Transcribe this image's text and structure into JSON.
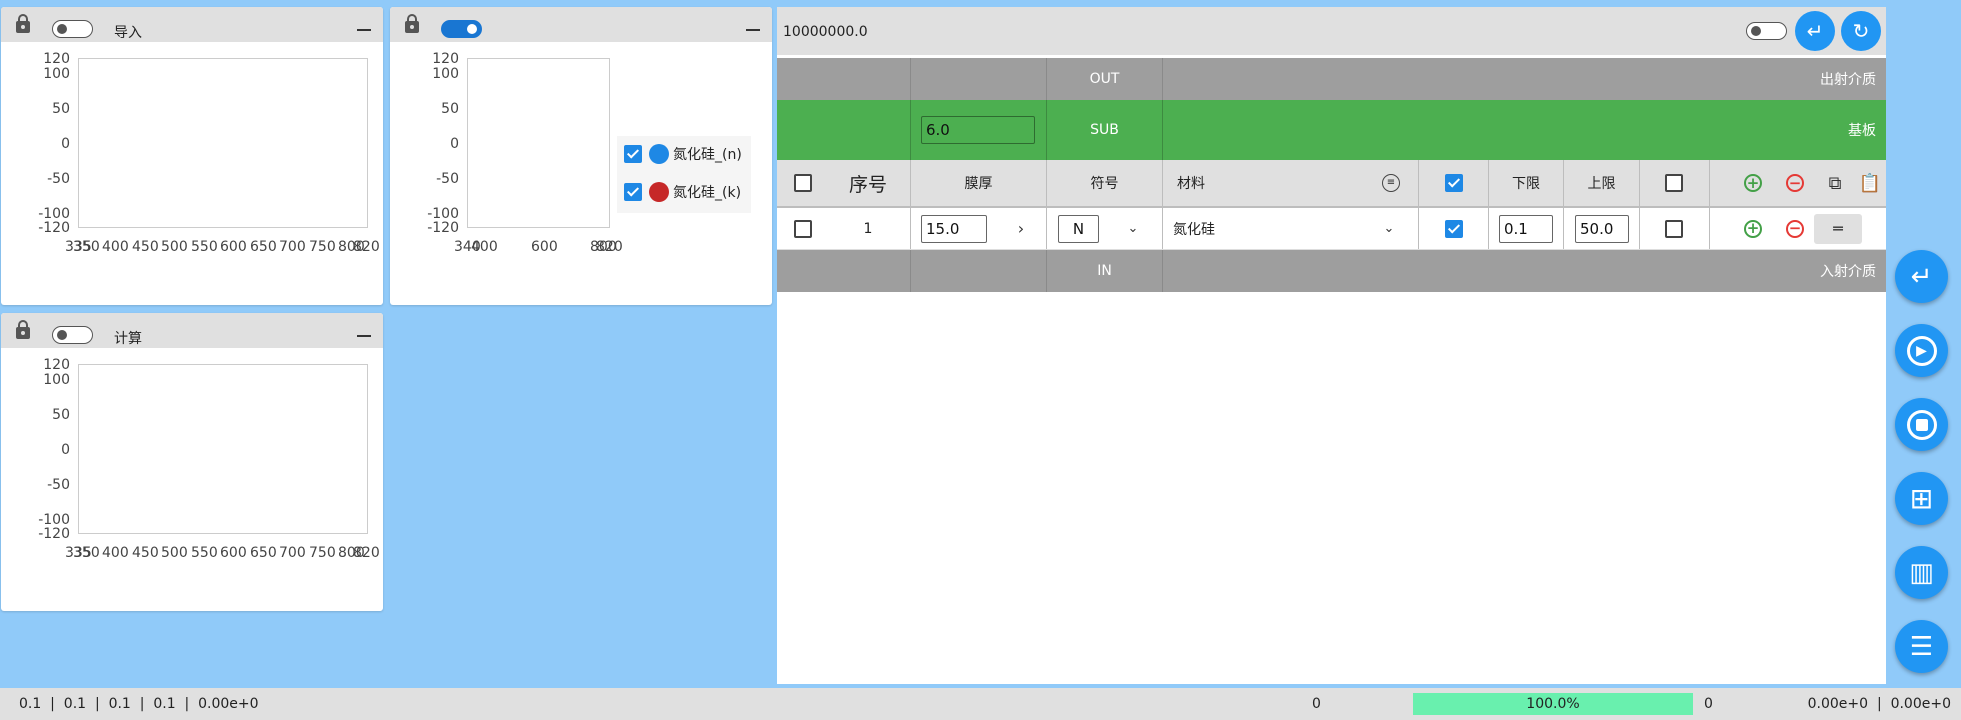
{
  "panels": {
    "import": {
      "title": "导入",
      "toggle_on": false
    },
    "plot2": {
      "toggle_on": true
    },
    "calc": {
      "title": "计算",
      "toggle_on": false
    }
  },
  "axes": {
    "y_ticks": [
      "120",
      "100",
      "50",
      "0",
      "-50",
      "-100",
      "-120"
    ],
    "x_ticks_a": [
      "335",
      "350",
      "400",
      "450",
      "500",
      "550",
      "600",
      "650",
      "700",
      "750",
      "800",
      "820"
    ],
    "x_ticks_b": [
      "340",
      "400",
      "600",
      "800",
      "820"
    ]
  },
  "legend": [
    {
      "label": "氮化硅_(n)",
      "color": "#1e88e5",
      "checked": true
    },
    {
      "label": "氮化硅_(k)",
      "color": "#c62828",
      "checked": true
    }
  ],
  "main": {
    "top_value": "10000000.0",
    "out_row": {
      "symbol": "OUT",
      "material": "出射介质"
    },
    "sub_row": {
      "thickness": "6.0",
      "symbol": "SUB",
      "material": "基板"
    },
    "header": {
      "index": "序号",
      "thickness": "膜厚",
      "symbol": "符号",
      "material": "材料",
      "lower": "下限",
      "upper": "上限"
    },
    "rows": [
      {
        "index": "1",
        "thickness": "15.0",
        "symbol": "N",
        "material": "氮化硅",
        "lower": "0.1",
        "upper": "50.0"
      }
    ],
    "in_row": {
      "symbol": "IN",
      "material": "入射介质"
    }
  },
  "status": {
    "left": "0.1  |  0.1  |  0.1  |  0.1  |  0.00e+0",
    "count_left": "0",
    "progress": "100.0%",
    "progress_value": 1.0,
    "count_right": "0",
    "right": "0.00e+0  |  0.00e+0"
  },
  "colors": {
    "background": "#90caf9",
    "accent": "#2196f3",
    "sub_row": "#4caf50",
    "progress": "#69f0ae"
  }
}
